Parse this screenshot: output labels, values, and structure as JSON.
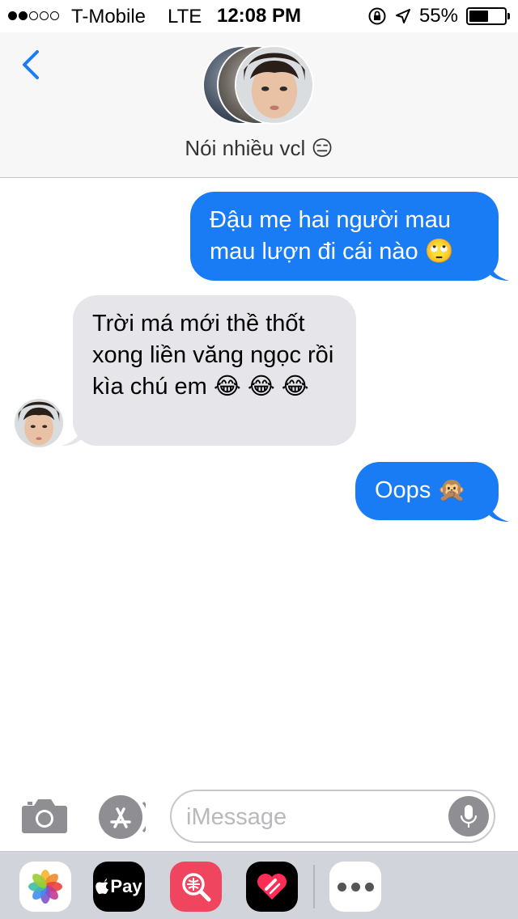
{
  "status_bar": {
    "carrier": "T-Mobile",
    "network": "LTE",
    "time": "12:08 PM",
    "battery": "55%",
    "battery_level": 0.55,
    "signal_bars": 2
  },
  "header": {
    "title": "Nói nhiều vcl 😑"
  },
  "messages": [
    {
      "direction": "outgoing",
      "text": "Đậu mẹ hai người mau mau lượn đi cái nào 🙄"
    },
    {
      "direction": "incoming",
      "text": "Trời má mới thề thốt xong liền văng ngọc rồi kìa chú em 😂 😂 😂"
    },
    {
      "direction": "outgoing",
      "text": "Oops 🙊"
    }
  ],
  "compose": {
    "placeholder": "iMessage"
  },
  "drawer": {
    "apple_pay_label": "Pay"
  },
  "colors": {
    "outgoing_bubble": "#1a7cf5",
    "incoming_bubble": "#e5e5ea",
    "accent": "#1a7cf5"
  },
  "icons": [
    "back-chevron-icon",
    "location-arrow-icon",
    "orientation-lock-icon",
    "camera-icon",
    "app-store-icon",
    "microphone-icon",
    "photos-icon",
    "apple-pay-icon",
    "image-search-icon",
    "digital-touch-icon",
    "more-icon"
  ]
}
